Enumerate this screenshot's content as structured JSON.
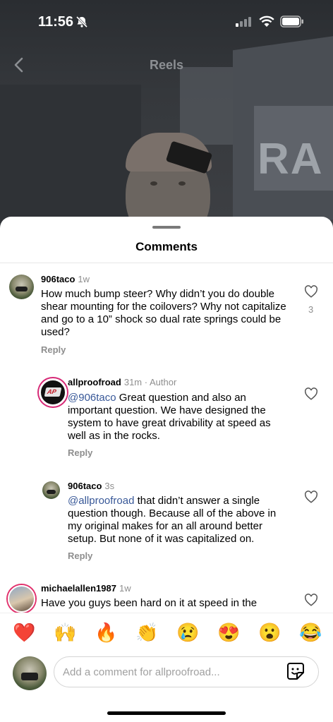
{
  "status": {
    "time": "11:56"
  },
  "header": {
    "title": "Reels"
  },
  "video": {
    "banner_text": "RA"
  },
  "sheet": {
    "title": "Comments"
  },
  "comments": [
    {
      "user": "906taco",
      "meta": "1w",
      "text": "How much bump steer? Why didn’t you do double shear mounting for the coilovers? Why not capitalize and go to a 10” shock so dual rate springs could be used?",
      "reply": "Reply",
      "likes": "3"
    },
    {
      "user": "allproofroad",
      "meta": "31m · Author",
      "mention": "@906taco",
      "text": " Great question and also an important question.  We have designed the system to have great drivability at speed as well as in the rocks.",
      "reply": "Reply"
    },
    {
      "user": "906taco",
      "meta": "3s",
      "mention": "@allproofroad",
      "text": " that didn’t answer a single question though. Because all of the above in my original makes for an all around better setup. But none of it was capitalized on.",
      "reply": "Reply"
    },
    {
      "user": "michaelallen1987",
      "meta": "1w",
      "text": "Have you guys been hard on it at speed in the"
    }
  ],
  "reactions": [
    "❤️",
    "🙌",
    "🔥",
    "👏",
    "😢",
    "😍",
    "😮",
    "😂"
  ],
  "composer": {
    "placeholder": "Add a comment for allproofroad..."
  }
}
